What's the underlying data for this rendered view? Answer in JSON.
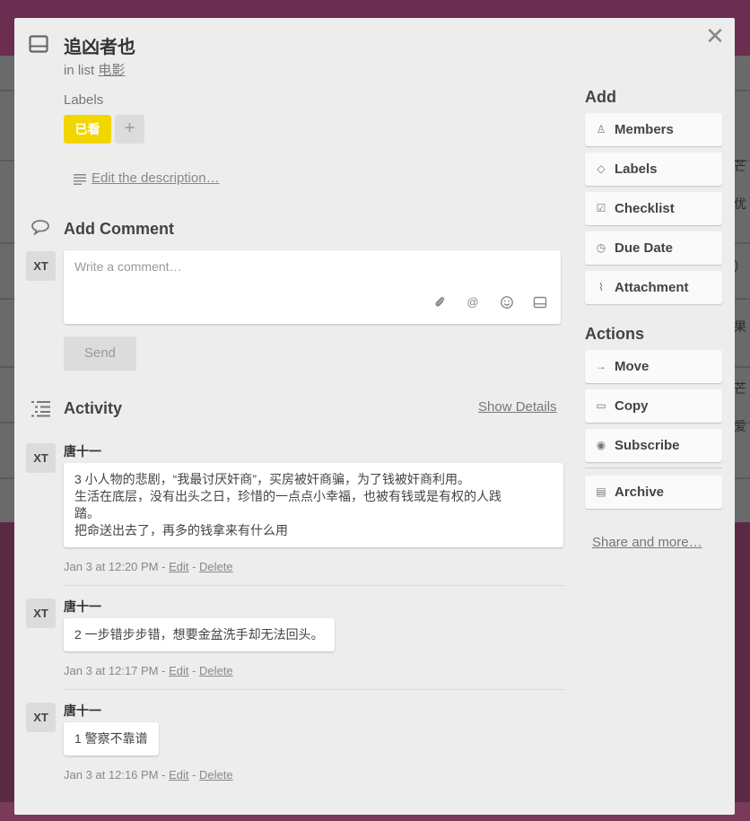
{
  "card": {
    "title": "追凶者也",
    "in_list_prefix": "in list",
    "list_name": "电影"
  },
  "labels": {
    "title": "Labels",
    "items": [
      {
        "text": "已看",
        "color": "#f2d600"
      }
    ],
    "add_symbol": "+"
  },
  "description": {
    "link": "Edit the description…"
  },
  "comment": {
    "title": "Add Comment",
    "avatar": "XT",
    "placeholder": "Write a comment…",
    "send": "Send",
    "icons": [
      "attachment-icon",
      "mention-icon",
      "emoji-icon",
      "card-icon"
    ]
  },
  "activity": {
    "title": "Activity",
    "show_details": "Show Details",
    "items": [
      {
        "avatar": "XT",
        "author": "唐十一",
        "text_lines": [
          "3 小人物的悲剧，“我最讨厌奸商”，买房被奸商骗，为了钱被奸商利用。",
          "生活在底层，没有出头之日，珍惜的一点点小幸福，也被有钱或是有权的人践",
          "踏。",
          "把命送出去了，再多的钱拿来有什么用"
        ],
        "time": "Jan 3 at 12:20 PM",
        "edit": "Edit",
        "delete": "Delete"
      },
      {
        "avatar": "XT",
        "author": "唐十一",
        "text_lines": [
          "2 一步错步步错，想要金盆洗手却无法回头。"
        ],
        "time": "Jan 3 at 12:17 PM",
        "edit": "Edit",
        "delete": "Delete"
      },
      {
        "avatar": "XT",
        "author": "唐十一",
        "text_lines": [
          "1 警察不靠谱"
        ],
        "time": "Jan 3 at 12:16 PM",
        "edit": "Edit",
        "delete": "Delete"
      }
    ]
  },
  "sidebar": {
    "add_title": "Add",
    "add_buttons": [
      {
        "label": "Members",
        "icon": "person-icon"
      },
      {
        "label": "Labels",
        "icon": "tag-icon"
      },
      {
        "label": "Checklist",
        "icon": "checkbox-icon"
      },
      {
        "label": "Due Date",
        "icon": "clock-icon"
      },
      {
        "label": "Attachment",
        "icon": "paperclip-icon"
      }
    ],
    "actions_title": "Actions",
    "action_buttons": [
      {
        "label": "Move",
        "icon": "arrow-right-icon"
      },
      {
        "label": "Copy",
        "icon": "copy-icon"
      },
      {
        "label": "Subscribe",
        "icon": "eye-icon"
      }
    ],
    "archive": {
      "label": "Archive",
      "icon": "archive-icon"
    },
    "share": "Share and more…"
  },
  "background": {
    "right_edge_glyphs": [
      "芒",
      "优",
      "）",
      "果",
      "芒",
      "爱"
    ]
  },
  "colors": {
    "label_yellow": "#f2d600",
    "modal_bg": "#ededed",
    "board_bg": "#6b2d50"
  }
}
